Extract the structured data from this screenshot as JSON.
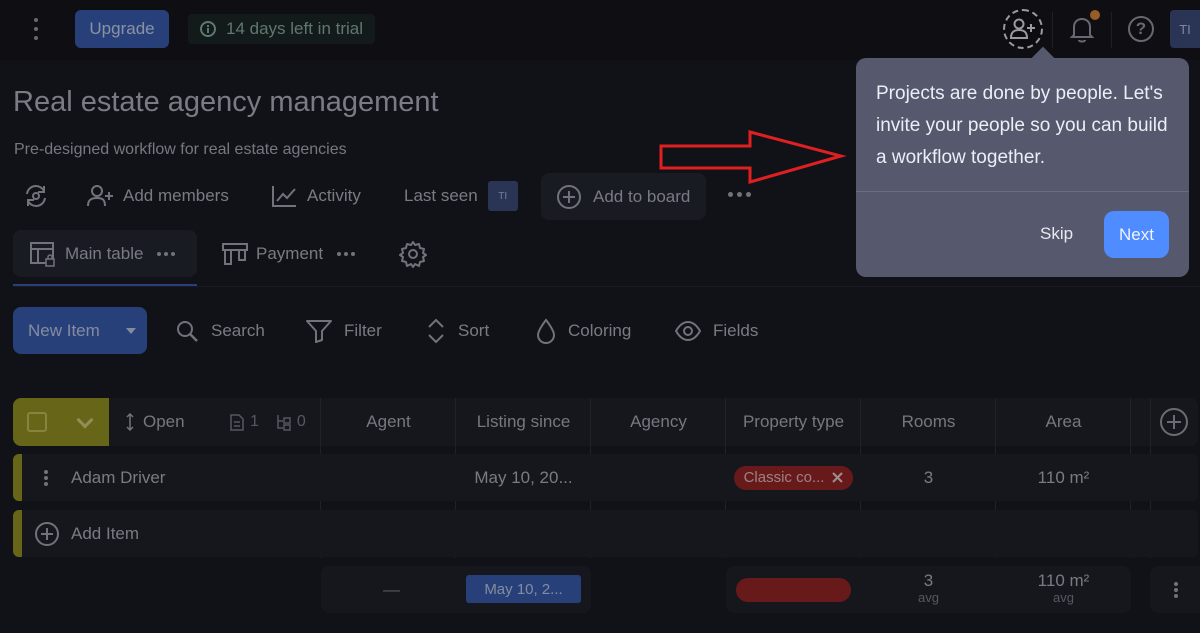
{
  "topbar": {
    "upgrade_label": "Upgrade",
    "trial_text": "14 days left in trial",
    "avatar_initials": "TI"
  },
  "board": {
    "title": "Real estate agency management",
    "subtitle": "Pre-designed workflow for real estate agencies"
  },
  "actions": {
    "add_members": "Add members",
    "activity": "Activity",
    "last_seen": "Last seen",
    "last_seen_avatar": "TI",
    "add_to_board": "Add to board"
  },
  "views": {
    "main_table": "Main table",
    "payment": "Payment"
  },
  "toolbar": {
    "new_item": "New Item",
    "search": "Search",
    "filter": "Filter",
    "sort": "Sort",
    "coloring": "Coloring",
    "fields": "Fields"
  },
  "table": {
    "open_label": "Open",
    "doc_count": "1",
    "subitem_count": "0",
    "columns": [
      "Agent",
      "Listing since",
      "Agency",
      "Property type",
      "Rooms",
      "Area"
    ],
    "rows": [
      {
        "name": "Adam Driver",
        "agent": "",
        "listing_since": "May 10, 20...",
        "agency": "",
        "property_type": "Classic co...",
        "rooms": "3",
        "area": "110 m²"
      }
    ],
    "add_item": "Add Item",
    "summary": {
      "agent": "—",
      "listing_since": "May 10, 2...",
      "rooms": "3",
      "rooms_sub": "avg",
      "area": "110 m²",
      "area_sub": "avg"
    }
  },
  "tour": {
    "message": "Projects are done by people. Let's invite your people so you can build a workflow together.",
    "skip": "Skip",
    "next": "Next"
  },
  "colors": {
    "accent": "#3a5fb4",
    "group": "#9a9820",
    "tag_red": "#9b2424",
    "next": "#4f8cff",
    "arrow": "#e02020"
  }
}
